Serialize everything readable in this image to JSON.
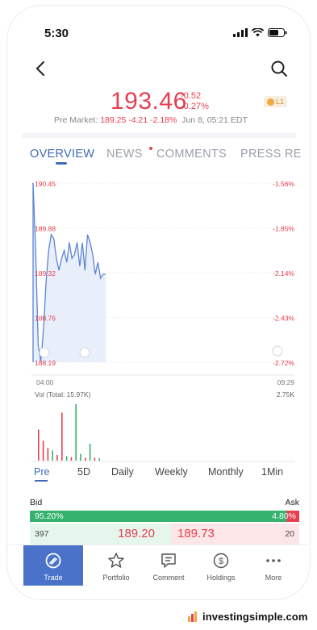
{
  "status": {
    "time": "5:30"
  },
  "quote": {
    "price": "193.46",
    "change": "-0.52",
    "change_pct": "-0.27%",
    "premarket_label": "Pre Market:",
    "premarket_price": "189.25",
    "premarket_change": "-4.21",
    "premarket_pct": "-2.18%",
    "timestamp": "Jun 8, 05:21 EDT",
    "badge": "L1",
    "colors": {
      "down": "#e5404f",
      "up": "#35b26e",
      "accent": "#4169b8"
    }
  },
  "tabs": [
    {
      "label": "OVERVIEW",
      "active": true
    },
    {
      "label": "NEWS",
      "has_dot": true
    },
    {
      "label": "COMMENTS"
    },
    {
      "label": "PRESS RE"
    }
  ],
  "chart_data": {
    "type": "line",
    "y_ticks_left": [
      "190.45",
      "189.88",
      "189.32",
      "188.76",
      "188.19"
    ],
    "y_ticks_right": [
      "-1.56%",
      "-1.85%",
      "-2.14%",
      "-2.43%",
      "-2.72%"
    ],
    "x_ticks": [
      "04:00",
      "09:29"
    ],
    "ylim": [
      188.19,
      190.45
    ],
    "price_series": [
      190.45,
      189.6,
      188.4,
      188.2,
      188.6,
      189.2,
      189.6,
      189.8,
      189.75,
      189.5,
      189.35,
      189.5,
      189.6,
      189.45,
      189.7,
      189.5,
      189.55,
      189.7,
      189.4,
      189.7,
      189.35,
      189.8,
      189.7,
      189.55,
      189.3,
      189.45,
      189.25,
      189.3,
      189.3
    ],
    "volume_label": "Vol (Total: 15.97K)",
    "volume_max_label": "2.75K",
    "volume_series": [
      {
        "v": 0.55,
        "c": "#e5404f"
      },
      {
        "v": 0.35,
        "c": "#e5404f"
      },
      {
        "v": 0.22,
        "c": "#e5404f"
      },
      {
        "v": 0.18,
        "c": "#35b26e"
      },
      {
        "v": 0.1,
        "c": "#e5404f"
      },
      {
        "v": 0.85,
        "c": "#e5404f"
      },
      {
        "v": 0.08,
        "c": "#35b26e"
      },
      {
        "v": 0.06,
        "c": "#e5404f"
      },
      {
        "v": 1.0,
        "c": "#35b26e"
      },
      {
        "v": 0.12,
        "c": "#35b26e"
      },
      {
        "v": 0.05,
        "c": "#e5404f"
      },
      {
        "v": 0.3,
        "c": "#35b26e"
      },
      {
        "v": 0.05,
        "c": "#e5404f"
      },
      {
        "v": 0.04,
        "c": "#35b26e"
      }
    ]
  },
  "periods": [
    {
      "label": "Pre",
      "active": true
    },
    {
      "label": "5D"
    },
    {
      "label": "Daily"
    },
    {
      "label": "Weekly"
    },
    {
      "label": "Monthly"
    },
    {
      "label": "1Min"
    }
  ],
  "book": {
    "bid_label": "Bid",
    "ask_label": "Ask",
    "bid_pct_text": "95.20%",
    "ask_pct_text": "4.80%",
    "bid_fraction": 0.952,
    "bid_size": "397",
    "bid_price": "189.20",
    "ask_price": "189.73",
    "ask_size": "20"
  },
  "tabbar": [
    {
      "label": "Trade",
      "icon": "trade-icon",
      "active": true
    },
    {
      "label": "Portfolio",
      "icon": "star-icon"
    },
    {
      "label": "Comment",
      "icon": "comment-icon"
    },
    {
      "label": "Holdings",
      "icon": "holdings-icon"
    },
    {
      "label": "More",
      "icon": "more-icon"
    }
  ],
  "brand": {
    "text": "investingsimple.com"
  }
}
